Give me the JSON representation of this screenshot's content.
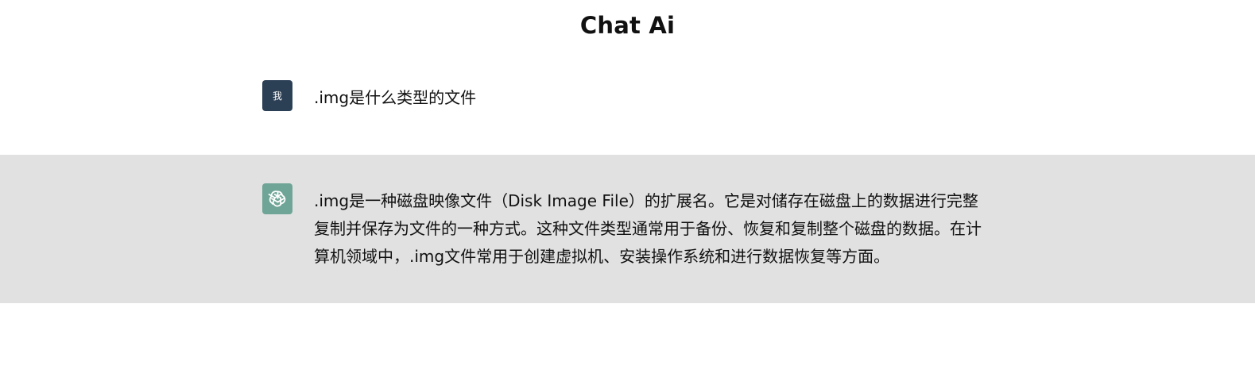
{
  "app": {
    "title": "Chat Ai"
  },
  "conversation": {
    "messages": [
      {
        "role": "user",
        "avatar_label": "我",
        "text": ".img是什么类型的文件"
      },
      {
        "role": "assistant",
        "avatar_icon": "openai-icon",
        "text": ".img是一种磁盘映像文件（Disk Image File）的扩展名。它是对储存在磁盘上的数据进行完整复制并保存为文件的一种方式。这种文件类型通常用于备份、恢复和复制整个磁盘的数据。在计算机领域中，.img文件常用于创建虚拟机、安装操作系统和进行数据恢复等方面。"
      }
    ]
  },
  "colors": {
    "page_background": "#ffffff",
    "assistant_background": "#e1e1e1",
    "user_avatar": "#2b3f55",
    "assistant_avatar": "#6fa596"
  }
}
